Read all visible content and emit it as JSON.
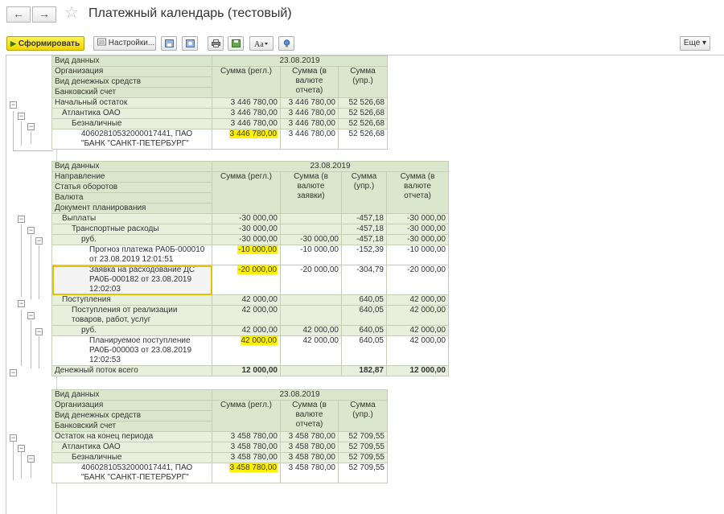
{
  "window": {
    "title": "Платежный календарь (тестовый)",
    "back_icon": "←",
    "forward_icon": "→",
    "favorite_icon": "☆"
  },
  "toolbar": {
    "generate_label": "Сформировать",
    "settings_label": "Настройки...",
    "more_label": "Еще",
    "more_arrow": "▾",
    "play_icon": "▶"
  },
  "table1": {
    "header": {
      "view": "Вид данных",
      "org": "Организация",
      "cash_type": "Вид денежных средств",
      "bank": "Банковский счет",
      "date": "23.08.2019",
      "col1": "Сумма (регл.)",
      "col2": "Сумма (в валюте отчета)",
      "col3": "Сумма (упр.)"
    },
    "rows": [
      {
        "label": "Начальный остаток",
        "c1": "3 446 780,00",
        "c2": "3 446 780,00",
        "c3": "52 526,68"
      },
      {
        "label": "Атлантика ОАО",
        "c1": "3 446 780,00",
        "c2": "3 446 780,00",
        "c3": "52 526,68"
      },
      {
        "label": "Безналичные",
        "c1": "3 446 780,00",
        "c2": "3 446 780,00",
        "c3": "52 526,68"
      },
      {
        "label": "40602810532000017441, ПАО \"БАНК \"САНКТ-ПЕТЕРБУРГ\"",
        "c1": "3 446 780,00",
        "c2": "3 446 780,00",
        "c3": "52 526,68"
      }
    ]
  },
  "table2": {
    "header": {
      "view": "Вид данных",
      "direction": "Направление",
      "item": "Статья оборотов",
      "currency": "Валюта",
      "doc": "Документ планирования",
      "date": "23.08.2019",
      "col1": "Сумма (регл.)",
      "col2": "Сумма (в валюте заявки)",
      "col3": "Сумма (упр.)",
      "col4": "Сумма (в валюте отчета)"
    },
    "rows": [
      {
        "label": "Выплаты",
        "c1": "-30 000,00",
        "c2": "",
        "c3": "-457,18",
        "c4": "-30 000,00"
      },
      {
        "label": "Транспортные расходы",
        "c1": "-30 000,00",
        "c2": "",
        "c3": "-457,18",
        "c4": "-30 000,00"
      },
      {
        "label": "руб.",
        "c1": "-30 000,00",
        "c2": "-30 000,00",
        "c3": "-457,18",
        "c4": "-30 000,00"
      },
      {
        "label": "Прогноз платежа РА0Б-000010 от 23.08.2019 12:01:51",
        "c1": "-10 000,00",
        "c2": "-10 000,00",
        "c3": "-152,39",
        "c4": "-10 000,00"
      },
      {
        "label": "Заявка на расходование ДС РА0Б-000182 от 23.08.2019 12:02:03",
        "c1": "-20 000,00",
        "c2": "-20 000,00",
        "c3": "-304,79",
        "c4": "-20 000,00"
      },
      {
        "label": "Поступления",
        "c1": "42 000,00",
        "c2": "",
        "c3": "640,05",
        "c4": "42 000,00"
      },
      {
        "label": "Поступления от реализации товаров, работ, услуг",
        "c1": "42 000,00",
        "c2": "",
        "c3": "640,05",
        "c4": "42 000,00"
      },
      {
        "label": "руб.",
        "c1": "42 000,00",
        "c2": "42 000,00",
        "c3": "640,05",
        "c4": "42 000,00"
      },
      {
        "label": "Планируемое поступление РА0Б-000003 от 23.08.2019 12:02:53",
        "c1": "42 000,00",
        "c2": "42 000,00",
        "c3": "640,05",
        "c4": "42 000,00"
      }
    ],
    "total": {
      "label": "Денежный поток всего",
      "c1": "12 000,00",
      "c2": "",
      "c3": "182,87",
      "c4": "12 000,00"
    }
  },
  "table3": {
    "header": {
      "view": "Вид данных",
      "org": "Организация",
      "cash_type": "Вид денежных средств",
      "bank": "Банковский счет",
      "date": "23.08.2019",
      "col1": "Сумма (регл.)",
      "col2": "Сумма (в валюте отчета)",
      "col3": "Сумма (упр.)"
    },
    "rows": [
      {
        "label": "Остаток на конец периода",
        "c1": "3 458 780,00",
        "c2": "3 458 780,00",
        "c3": "52 709,55"
      },
      {
        "label": "Атлантика ОАО",
        "c1": "3 458 780,00",
        "c2": "3 458 780,00",
        "c3": "52 709,55"
      },
      {
        "label": "Безналичные",
        "c1": "3 458 780,00",
        "c2": "3 458 780,00",
        "c3": "52 709,55"
      },
      {
        "label": "40602810532000017441, ПАО \"БАНК \"САНКТ-ПЕТЕРБУРГ\"",
        "c1": "3 458 780,00",
        "c2": "3 458 780,00",
        "c3": "52 709,55"
      }
    ]
  },
  "tree_expander_glyph": "−"
}
